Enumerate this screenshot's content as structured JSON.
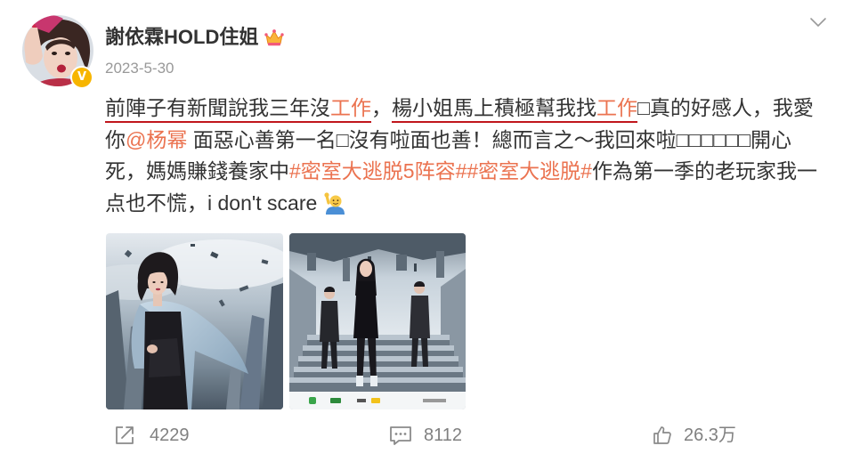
{
  "post": {
    "author": {
      "name": "謝依霖HOLD住姐",
      "verified_mark": "V",
      "avatar_icon": "avatar-photo",
      "verified_icon": "verified-badge-icon",
      "vip_icon": "crown-icon"
    },
    "date": "2023-5-30",
    "menu_icon": "chevron-down-icon",
    "lines": [
      [
        {
          "text": "前陣子有新聞說我三年沒",
          "underline": true
        },
        {
          "text": "工作",
          "link": true,
          "underline": true
        },
        {
          "text": "，"
        },
        {
          "text": "楊小姐馬上積極幫我找",
          "underline": true
        },
        {
          "text": "工作",
          "link": true,
          "underline": true
        },
        {
          "text": "□真的好感人，我愛"
        }
      ],
      [
        {
          "text": "你"
        },
        {
          "text": "@杨幂",
          "link": true
        },
        {
          "text": " 面惡心善第一名□沒有啦面也善！總而言之～我回來啦□□□□□□開心"
        }
      ],
      [
        {
          "text": "死，媽媽賺錢養家中"
        },
        {
          "text": "#密室大逃脱5阵容#",
          "link": true
        },
        {
          "text": "#密室大逃脱#",
          "link": true
        },
        {
          "text": "作為第一季的老玩家我一"
        }
      ],
      [
        {
          "text": "点也不慌，i don't scare "
        },
        {
          "emoji_icon": "raising-hand-emoji-icon"
        }
      ]
    ],
    "images": [
      {
        "icon": "post-photo-1"
      },
      {
        "icon": "post-photo-2"
      }
    ]
  },
  "actions": {
    "repost": {
      "icon": "share-icon",
      "count": "4229"
    },
    "comment": {
      "icon": "comment-icon",
      "count": "8112"
    },
    "like": {
      "icon": "thumbs-up-icon",
      "count": "26.3万"
    }
  },
  "colors": {
    "text": "#333333",
    "link": "#eb7350",
    "muted": "#999999",
    "annotation_underline": "#c0161c",
    "verified_badge": "#f7b500",
    "action_icon": "#8a8a8a"
  }
}
